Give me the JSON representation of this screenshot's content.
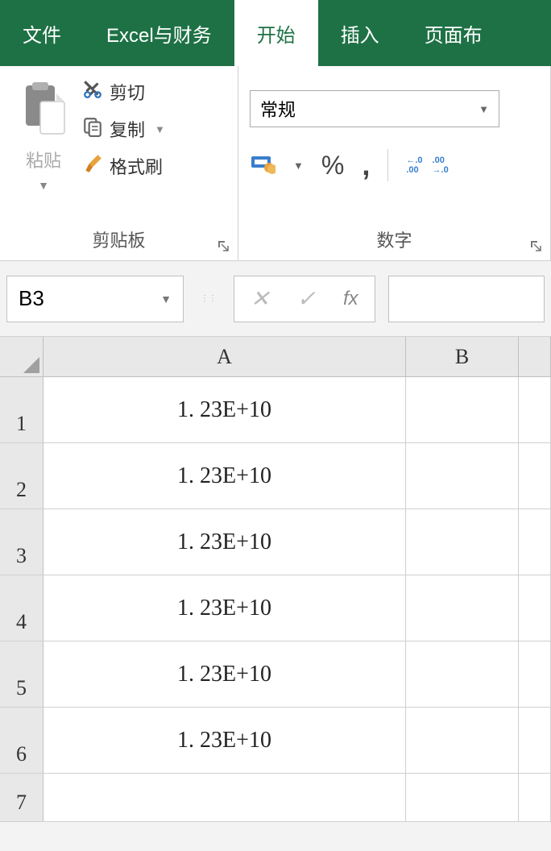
{
  "tabs": {
    "file": "文件",
    "custom": "Excel与财务",
    "home": "开始",
    "insert": "插入",
    "pagelayout": "页面布"
  },
  "ribbon": {
    "clipboard": {
      "paste": "粘贴",
      "cut": "剪切",
      "copy": "复制",
      "formatpainter": "格式刷",
      "group_label": "剪贴板"
    },
    "number": {
      "format_selected": "常规",
      "group_label": "数字",
      "dec_increase_top": "←.0",
      "dec_increase_bot": ".00",
      "dec_decrease_top": ".00",
      "dec_decrease_bot": "→.0"
    }
  },
  "namebox": {
    "value": "B3"
  },
  "formula_fx": "fx",
  "columns": {
    "a": "A",
    "b": "B"
  },
  "rows": [
    "1",
    "2",
    "3",
    "4",
    "5",
    "6",
    "7"
  ],
  "cells": {
    "a1": "1. 23E+10",
    "a2": "1. 23E+10",
    "a3": "1. 23E+10",
    "a4": "1. 23E+10",
    "a5": "1. 23E+10",
    "a6": "1. 23E+10"
  }
}
